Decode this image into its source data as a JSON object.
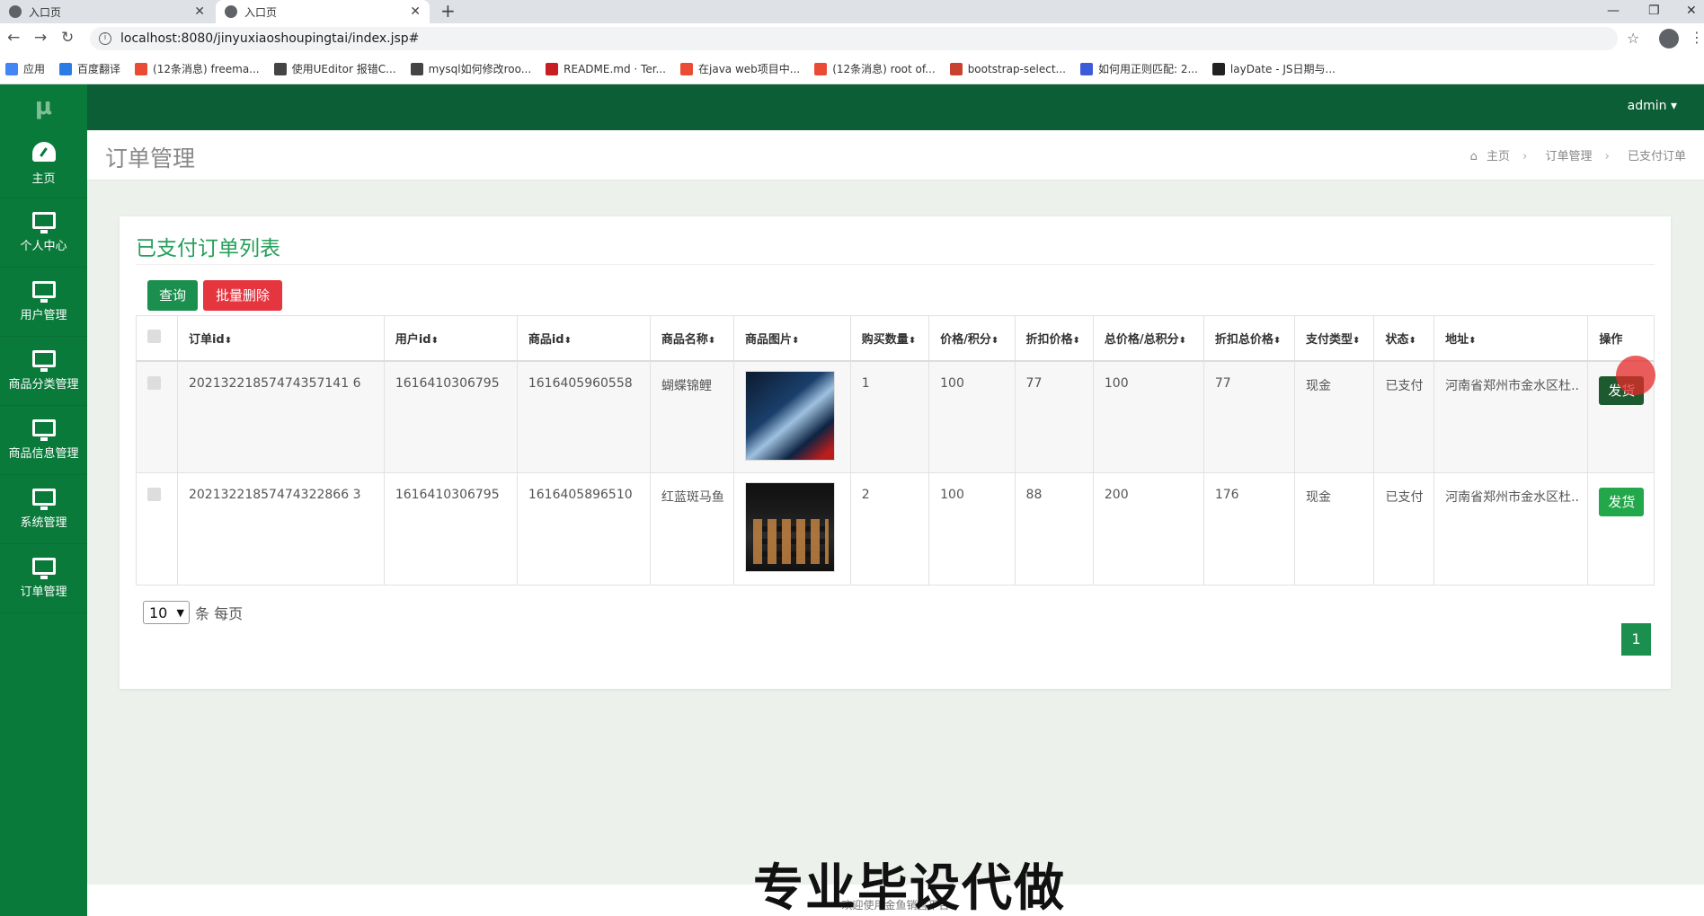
{
  "browser": {
    "tabs": [
      {
        "title": "入口页",
        "close": "✕"
      },
      {
        "title": "入口页",
        "close": "✕"
      }
    ],
    "new_tab": "+",
    "win_min": "—",
    "win_restore": "❐",
    "win_close": "✕",
    "url": "localhost:8080/jinyuxiaoshoupingtai/index.jsp#",
    "bookmarks": [
      {
        "label": "应用",
        "color": "#4285f4"
      },
      {
        "label": "百度翻译",
        "color": "#2b7be6"
      },
      {
        "label": "(12条消息) freema...",
        "color": "#e94b35"
      },
      {
        "label": "使用UEditor 报错C...",
        "color": "#444444"
      },
      {
        "label": "mysql如何修改roo...",
        "color": "#444444"
      },
      {
        "label": "README.md · Ter...",
        "color": "#c71d23"
      },
      {
        "label": "在java web项目中...",
        "color": "#e94b35"
      },
      {
        "label": "(12条消息) root of...",
        "color": "#e94b35"
      },
      {
        "label": "bootstrap-select...",
        "color": "#c9412f"
      },
      {
        "label": "如何用正则匹配: 2...",
        "color": "#3d5bd9"
      },
      {
        "label": "layDate - JS日期与...",
        "color": "#222222"
      }
    ]
  },
  "app": {
    "logo": "μ",
    "admin": "admin ▾",
    "sidebar": [
      {
        "label": "主页",
        "icon": "dashboard-icon"
      },
      {
        "label": "个人中心",
        "icon": "monitor-icon"
      },
      {
        "label": "用户管理",
        "icon": "monitor-icon"
      },
      {
        "label": "商品分类管理",
        "icon": "monitor-icon"
      },
      {
        "label": "商品信息管理",
        "icon": "monitor-icon"
      },
      {
        "label": "系统管理",
        "icon": "monitor-icon"
      },
      {
        "label": "订单管理",
        "icon": "monitor-icon"
      }
    ],
    "page_title": "订单管理",
    "breadcrumb": {
      "home": "主页",
      "sep": "›",
      "level1": "订单管理",
      "level2": "已支付订单"
    },
    "panel_title": "已支付订单列表",
    "btn_query": "查询",
    "btn_batch_delete": "批量删除",
    "columns": [
      "订单id",
      "用户id",
      "商品id",
      "商品名称",
      "商品图片",
      "购买数量",
      "价格/积分",
      "折扣价格",
      "总价格/总积分",
      "折扣总价格",
      "支付类型",
      "状态",
      "地址",
      "操作"
    ],
    "sort_icon": "⬍",
    "rows": [
      {
        "order_id": "20213221857474357141 6",
        "user_id": "1616410306795",
        "product_id": "1616405960558",
        "name": "蝴蝶锦鲤",
        "qty": "1",
        "price": "100",
        "discount": "77",
        "total": "100",
        "discount_total": "77",
        "pay_type": "现金",
        "status": "已支付",
        "address": "河南省郑州市金水区杜..",
        "action": "发货"
      },
      {
        "order_id": "20213221857474322866 3",
        "user_id": "1616410306795",
        "product_id": "1616405896510",
        "name": "红蓝斑马鱼",
        "qty": "2",
        "price": "100",
        "discount": "88",
        "total": "200",
        "discount_total": "176",
        "pay_type": "现金",
        "status": "已支付",
        "address": "河南省郑州市金水区杜..",
        "action": "发货"
      }
    ],
    "page_size": "10",
    "page_size_suffix": "条 每页",
    "current_page": "1",
    "footer": "欢迎使用金鱼销售平台",
    "watermark": "专业毕设代做"
  }
}
